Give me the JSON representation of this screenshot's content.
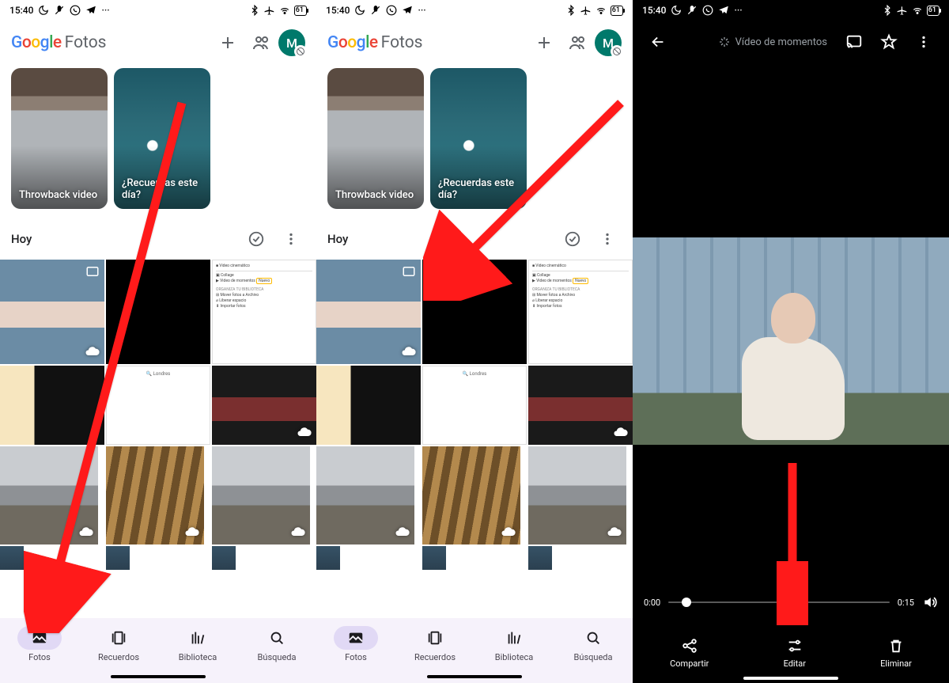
{
  "statusbar": {
    "time": "15:40",
    "battery": "61"
  },
  "header": {
    "logo_fotos": "Fotos",
    "avatar_letter": "M"
  },
  "memories": {
    "card1_label": "Throwback video",
    "card2_label": "¿Recuerdas este día?"
  },
  "section": {
    "today": "Hoy"
  },
  "nav": {
    "fotos": "Fotos",
    "recuerdos": "Recuerdos",
    "biblioteca": "Biblioteca",
    "busqueda": "Búsqueda"
  },
  "viewer": {
    "moments": "Vídeo de momentos",
    "time_start": "0:00",
    "time_end": "0:15",
    "compartir": "Compartir",
    "editar": "Editar",
    "eliminar": "Eliminar"
  },
  "screenshot_menu": {
    "video_cine": "Video cinemático",
    "collage": "Collage",
    "video_momentos": "Video de momentos",
    "mover": "Mover fotos a Archivo",
    "liberar": "Liberar espacio",
    "importar": "Importar fotos",
    "londres": "Londres"
  }
}
